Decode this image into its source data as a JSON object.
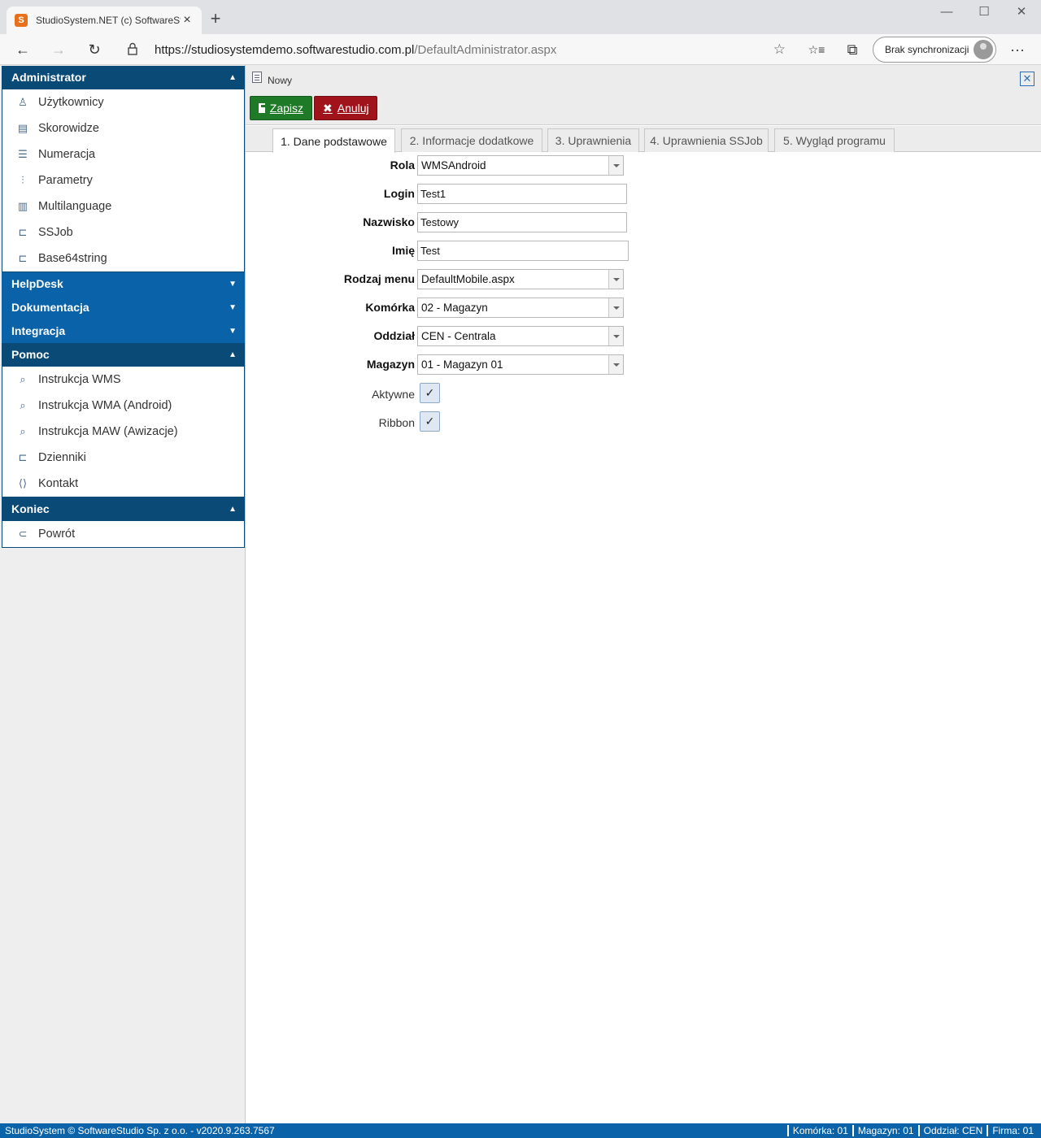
{
  "browser": {
    "tab_title": "StudioSystem.NET (c) SoftwareSt",
    "tab_close": "×",
    "new_tab": "+",
    "url_host": "https://studiosystemdemo.softwarestudio.com.pl",
    "url_path": "/DefaultAdministrator.aspx",
    "sync_label": "Brak synchronizacji",
    "min": "—",
    "max": "☐",
    "close": "✕",
    "back": "←",
    "forward": "→",
    "reload": "↻",
    "star": "☆",
    "favorites": "☆≡",
    "collections": "⧉",
    "more": "···"
  },
  "sidebar": {
    "sections": [
      {
        "title": "Administrator",
        "arrow": "▲",
        "items": [
          {
            "label": "Użytkownicy",
            "icon": "user-icon"
          },
          {
            "label": "Skorowidze",
            "icon": "book-icon"
          },
          {
            "label": "Numeracja",
            "icon": "list-icon"
          },
          {
            "label": "Parametry",
            "icon": "sliders-icon"
          },
          {
            "label": "Multilanguage",
            "icon": "document-icon"
          },
          {
            "label": "SSJob",
            "icon": "tree-icon"
          },
          {
            "label": "Base64string",
            "icon": "tree-icon"
          }
        ]
      },
      {
        "title": "HelpDesk",
        "arrow": "▼"
      },
      {
        "title": "Dokumentacja",
        "arrow": "▼"
      },
      {
        "title": "Integracja",
        "arrow": "▼"
      },
      {
        "title": "Pomoc",
        "arrow": "▲",
        "items": [
          {
            "label": "Instrukcja WMS",
            "icon": "search-icon"
          },
          {
            "label": "Instrukcja WMA (Android)",
            "icon": "search-icon"
          },
          {
            "label": "Instrukcja MAW (Awizacje)",
            "icon": "search-icon"
          },
          {
            "label": "Dzienniki",
            "icon": "tree-icon"
          },
          {
            "label": "Kontakt",
            "icon": "code-icon"
          }
        ]
      },
      {
        "title": "Koniec",
        "arrow": "▲",
        "items": [
          {
            "label": "Powrót",
            "icon": "back-circle-icon"
          }
        ]
      }
    ]
  },
  "main": {
    "crumb": "Nowy",
    "close_label": "✕",
    "toolbar": {
      "save": "Zapisz",
      "cancel": "Anuluj",
      "cancel_icon": "✖"
    },
    "tabs": [
      "1. Dane podstawowe",
      "2. Informacje dodatkowe",
      "3. Uprawnienia",
      "4. Uprawnienia SSJob",
      "5. Wygląd programu"
    ],
    "form": {
      "rola": {
        "label": "Rola",
        "value": "WMSAndroid"
      },
      "login": {
        "label": "Login",
        "value": "Test1"
      },
      "nazwisko": {
        "label": "Nazwisko",
        "value": "Testowy"
      },
      "imie": {
        "label": "Imię",
        "value": "Test"
      },
      "rodzaj_menu": {
        "label": "Rodzaj menu",
        "value": "DefaultMobile.aspx"
      },
      "komorka": {
        "label": "Komórka",
        "value": "02 - Magazyn"
      },
      "oddzial": {
        "label": "Oddział",
        "value": "CEN - Centrala"
      },
      "magazyn": {
        "label": "Magazyn",
        "value": "01 - Magazyn 01"
      },
      "aktywne": {
        "label": "Aktywne",
        "checked": true,
        "mark": "✓"
      },
      "ribbon": {
        "label": "Ribbon",
        "checked": true,
        "mark": "✓"
      }
    }
  },
  "status": {
    "left": "StudioSystem © SoftwareStudio Sp. z o.o. - v2020.9.263.7567",
    "komorka": "Komórka: 01",
    "magazyn": "Magazyn: 01",
    "oddzial": "Oddział: CEN",
    "firma": "Firma: 01"
  }
}
